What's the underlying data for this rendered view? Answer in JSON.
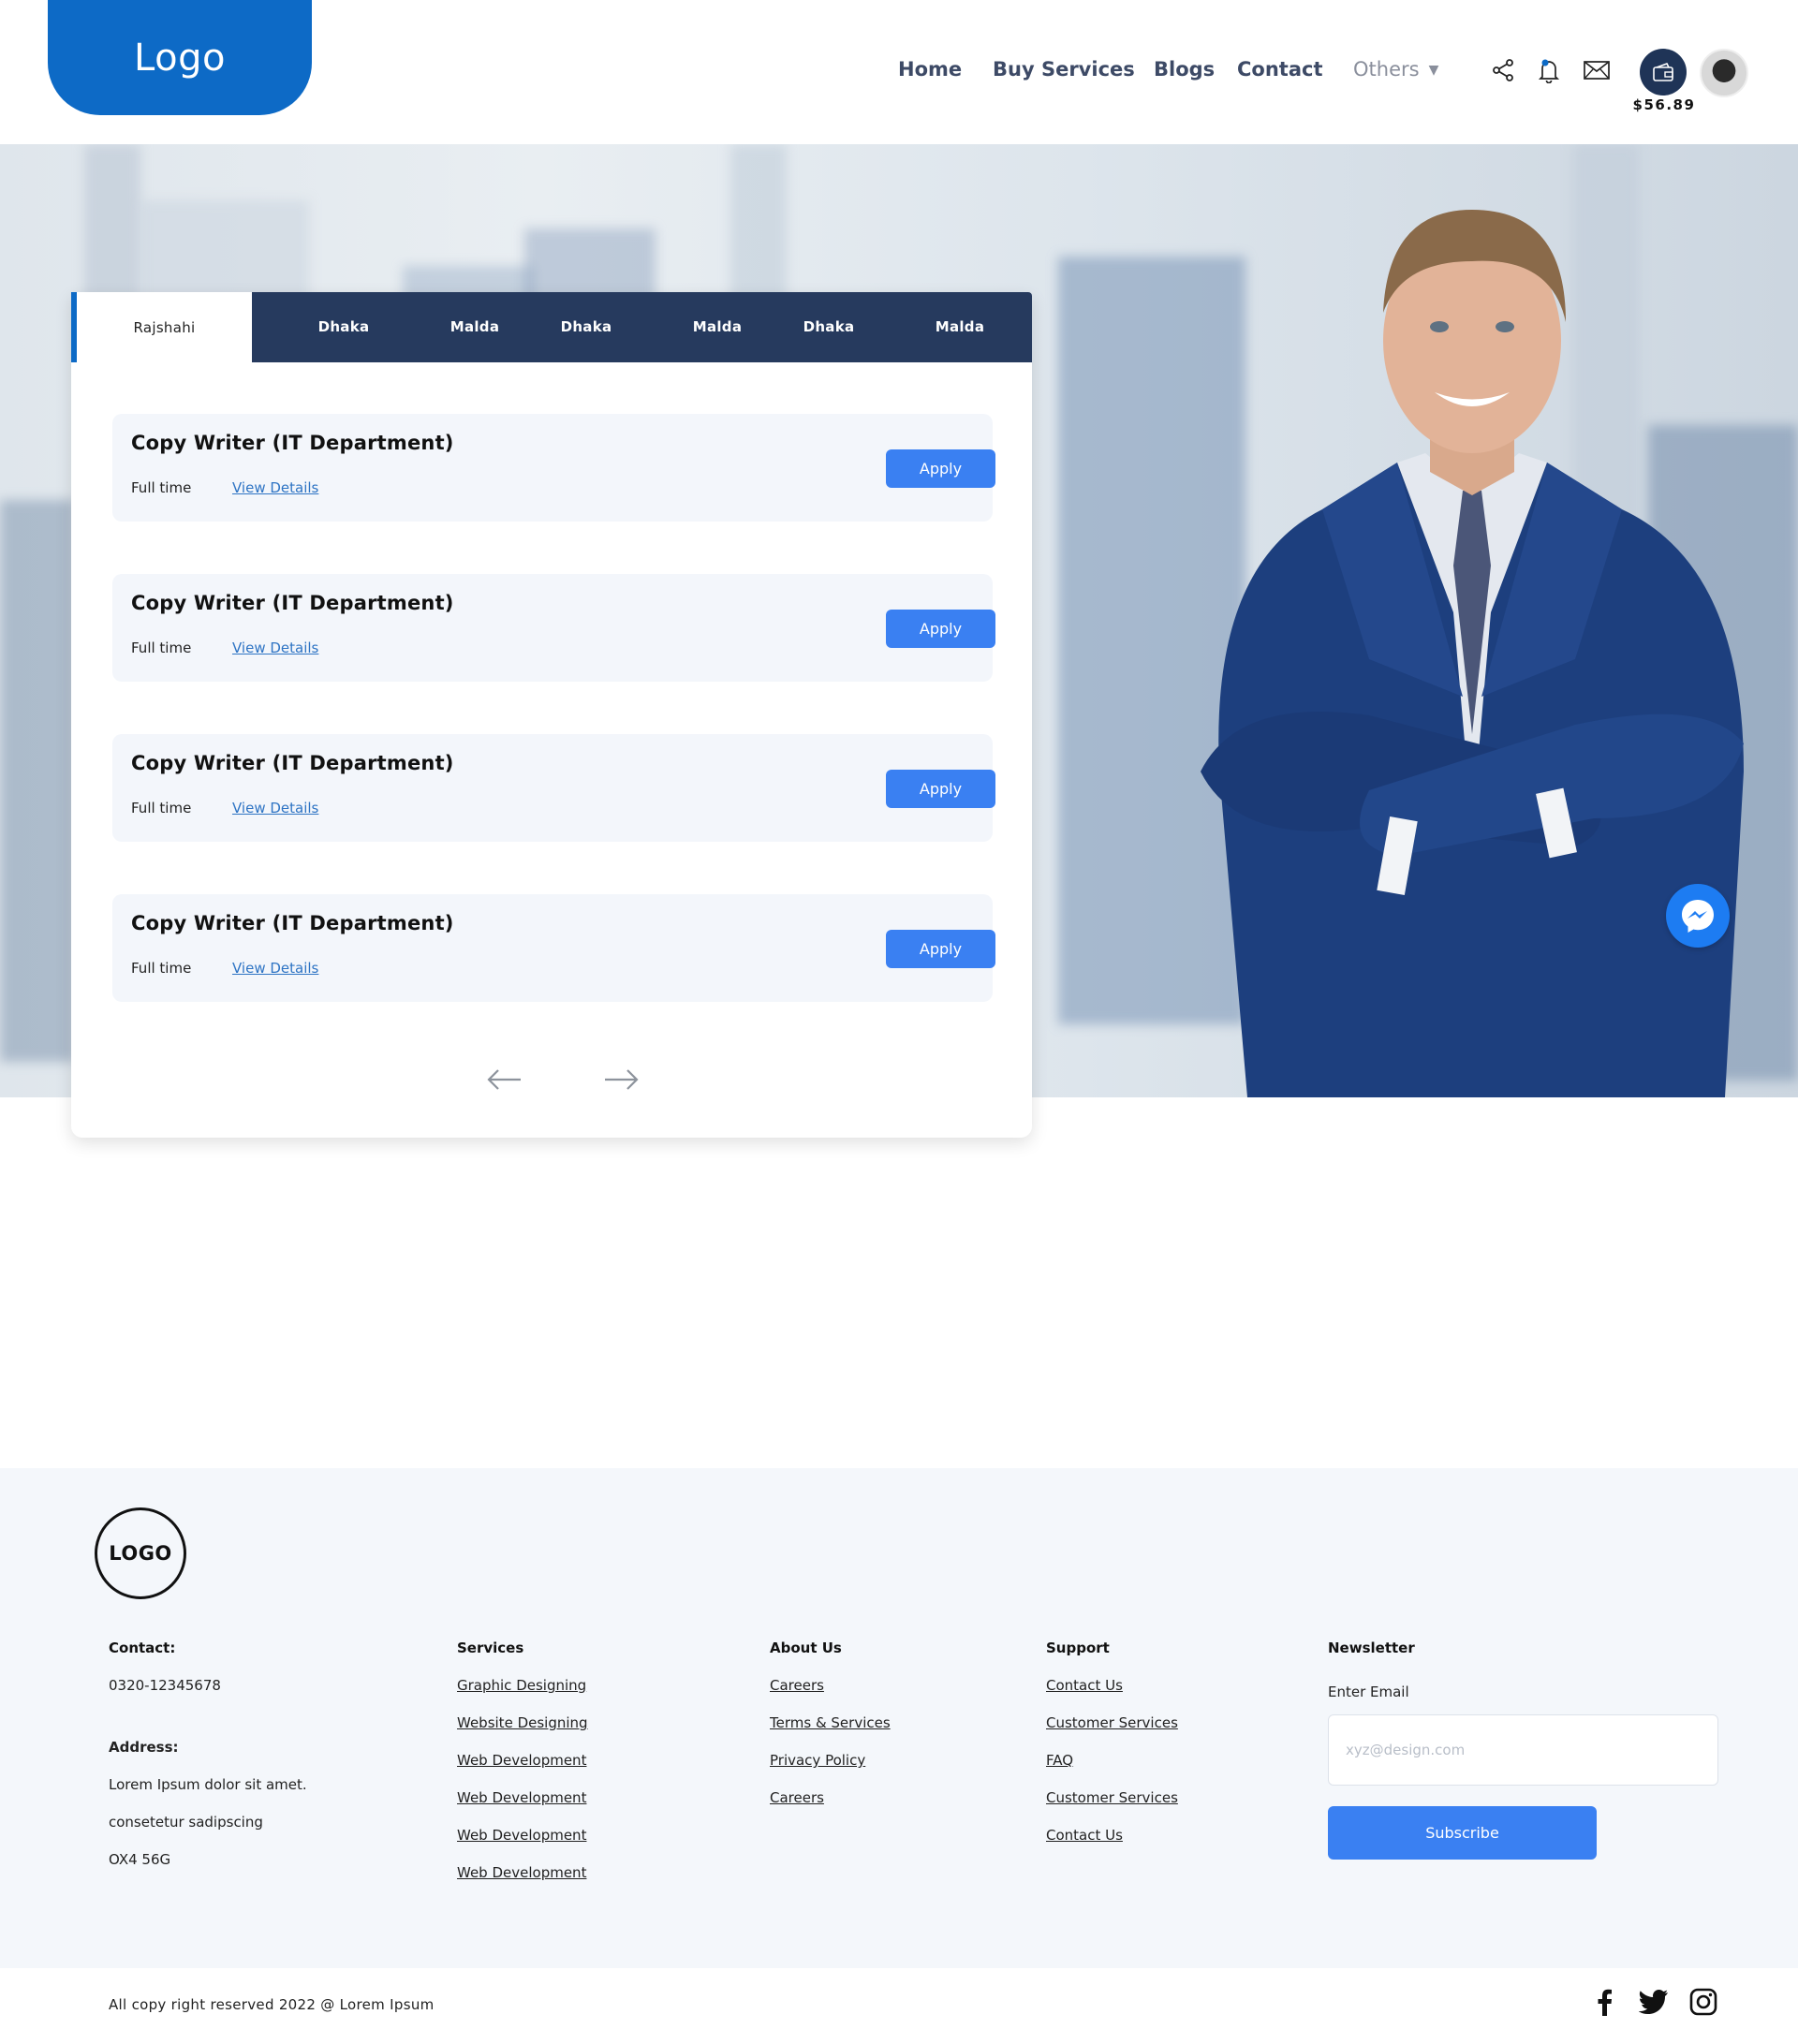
{
  "header": {
    "logo_text": "Logo",
    "nav": [
      {
        "label": "Home"
      },
      {
        "label": "Buy Services"
      },
      {
        "label": "Blogs"
      },
      {
        "label": "Contact"
      },
      {
        "label": "Others"
      }
    ],
    "icons": [
      "share-icon",
      "bell-icon",
      "mail-icon",
      "wallet-icon"
    ],
    "wallet_balance": "$56.89",
    "accent_color": "#0d6ac6"
  },
  "jobs": {
    "tabs": [
      {
        "label": "Rajshahi",
        "active": true
      },
      {
        "label": "Dhaka"
      },
      {
        "label": "Malda"
      },
      {
        "label": "Dhaka"
      },
      {
        "label": "Malda"
      },
      {
        "label": "Dhaka"
      },
      {
        "label": "Malda"
      }
    ],
    "listings": [
      {
        "title": "Copy Writer (IT Department)",
        "type": "Full time",
        "details_link": "View Details",
        "apply_label": "Apply"
      },
      {
        "title": "Copy Writer (IT Department)",
        "type": "Full time",
        "details_link": "View Details",
        "apply_label": "Apply"
      },
      {
        "title": "Copy Writer (IT Department)",
        "type": "Full time",
        "details_link": "View Details",
        "apply_label": "Apply"
      },
      {
        "title": "Copy Writer (IT Department)",
        "type": "Full time",
        "details_link": "View Details",
        "apply_label": "Apply"
      }
    ],
    "pagination": {
      "prev_icon": "arrow-left-icon",
      "next_icon": "arrow-right-icon"
    },
    "button_color": "#3a80f2",
    "tabbar_color": "#263a5e"
  },
  "footer": {
    "logo_text": "LOGO",
    "contact": {
      "heading": "Contact:",
      "phone": "0320-12345678",
      "address_heading": "Address:",
      "address_lines": [
        "Lorem Ipsum dolor sit amet.",
        "consetetur sadipscing",
        "OX4 56G"
      ]
    },
    "services": {
      "heading": "Services",
      "items": [
        "Graphic Designing",
        "Website Designing",
        "Web Development",
        "Web Development",
        "Web Development",
        "Web Development"
      ]
    },
    "about": {
      "heading": "About Us",
      "items": [
        "Careers",
        "Terms & Services",
        "Privacy Policy",
        "Careers"
      ]
    },
    "support": {
      "heading": "Support",
      "items": [
        "Contact Us",
        "Customer Services",
        "FAQ",
        "Customer Services",
        "Contact Us"
      ]
    },
    "newsletter": {
      "heading": "Newsletter",
      "label": "Enter Email",
      "placeholder": "xyz@design.com",
      "button_label": "Subscribe"
    },
    "copyright": "All copy right reserved 2022 @ Lorem Ipsum",
    "social_icons": [
      "facebook-icon",
      "twitter-icon",
      "instagram-icon"
    ]
  }
}
